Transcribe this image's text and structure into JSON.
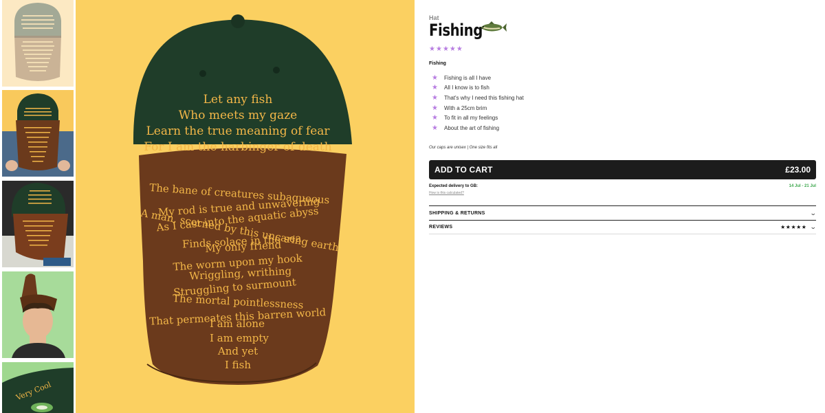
{
  "product": {
    "category": "Hat",
    "title": "Fishing",
    "rating_stars": "★★★★★",
    "sub_label": "Fishing",
    "features": [
      "Fishing is all I have",
      "All I know is to fish",
      "That's why I need this fishing hat",
      "With a 25cm brim",
      "To fit in all my feelings",
      "About the art of fishing"
    ],
    "note": "Our caps are unisex | One size fits all",
    "price": "£23.00",
    "add_to_cart_label": "ADD TO CART"
  },
  "delivery": {
    "label": "Expected delivery to GB:",
    "dates": "14 Jul - 21 Jul",
    "calc_link": "How is this calculated?"
  },
  "accordions": {
    "shipping_label": "SHIPPING & RETURNS",
    "reviews_label": "REVIEWS",
    "reviews_stars": "★★★★★"
  },
  "cap_text": {
    "crown": [
      "Let any fish",
      "Who meets my gaze",
      "Learn the true meaning of fear",
      "For I am the harbinger of death"
    ],
    "brim": [
      "The bane of creatures subaqueous",
      "My rod is true and unwavering",
      "As I cast into the aquatic abyss",
      "A man, scorned by this uncaring earth",
      "Finds solace in the sea",
      "My only friend",
      "The worm upon my hook",
      "Wriggling, writhing",
      "Struggling to surmount",
      "The mortal pointlessness",
      "That permeates this barren world",
      "I am alone",
      "I am empty",
      "And yet",
      "I fish"
    ],
    "thumb_brim_small": "Very Cool"
  },
  "colors": {
    "accent_star": "#b77de1",
    "cart_bg": "#1c1c1c",
    "delivery_green": "#3aa64a",
    "main_bg": "#fbd061",
    "cap_green": "#1f3d29",
    "cap_brown": "#6b3a1c",
    "embroidery": "#f3b748"
  },
  "icons": {
    "rating_star": "star-icon",
    "fish": "fish-icon",
    "chevron": "chevron-down-icon"
  }
}
